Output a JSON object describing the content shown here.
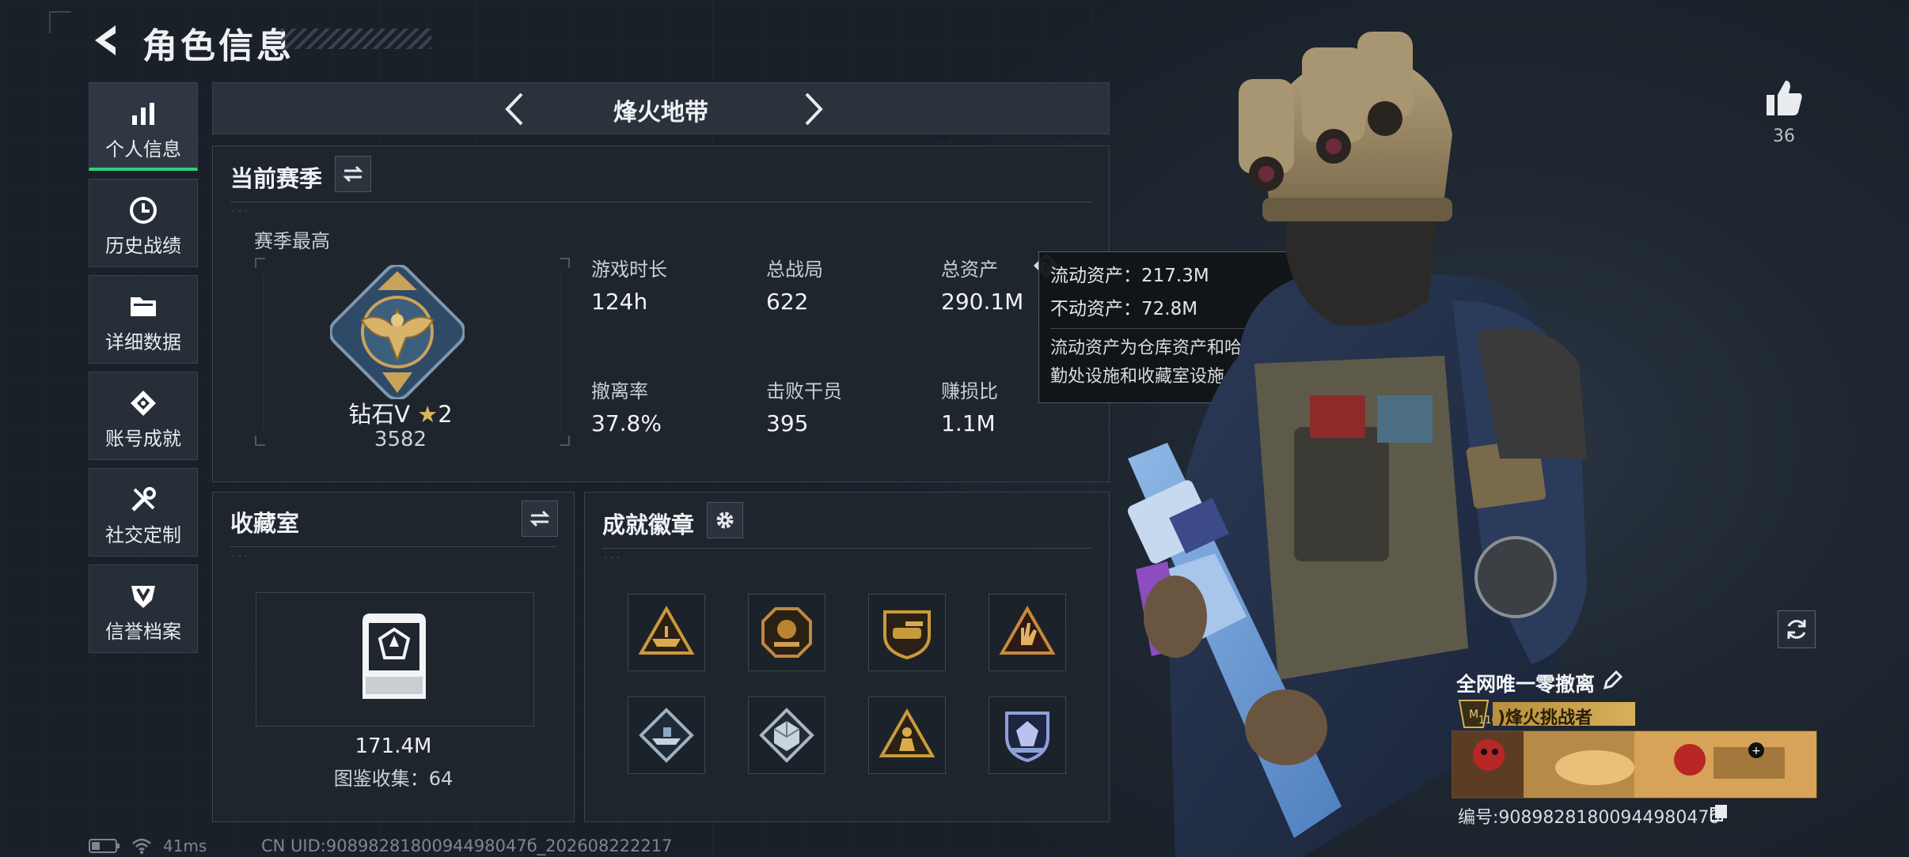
{
  "header": {
    "title": "角色信息"
  },
  "sidebar": {
    "items": [
      {
        "label": "个人信息",
        "icon": "bar-chart-icon",
        "active": true
      },
      {
        "label": "历史战绩",
        "icon": "clock-icon",
        "active": false
      },
      {
        "label": "详细数据",
        "icon": "folder-icon",
        "active": false
      },
      {
        "label": "账号成就",
        "icon": "achievement-icon",
        "active": false
      },
      {
        "label": "社交定制",
        "icon": "tools-icon",
        "active": false
      },
      {
        "label": "信誉档案",
        "icon": "credit-icon",
        "active": false
      }
    ]
  },
  "mode": {
    "label": "烽火地带"
  },
  "season": {
    "title": "当前赛季",
    "best_label": "赛季最高",
    "rank_name": "钻石V",
    "rank_stars": "2",
    "rank_score": "3582",
    "stats": [
      {
        "label": "游戏时长",
        "value": "124h"
      },
      {
        "label": "总战局",
        "value": "622"
      },
      {
        "label": "总资产",
        "value": "290.1M"
      },
      {
        "label": "撤离率",
        "value": "37.8%"
      },
      {
        "label": "击败干员",
        "value": "395"
      },
      {
        "label": "赚损比",
        "value": "1.1M"
      }
    ]
  },
  "tooltip": {
    "liquid": "流动资产：217.3M",
    "fixed": "不动资产：72.8M",
    "desc": "流动资产为仓库资产和哈夫币，不动资产为特勤处设施和收藏室设施"
  },
  "collection": {
    "title": "收藏室",
    "value": "171.4M",
    "count_label": "图鉴收集：64"
  },
  "badges": {
    "title": "成就徽章",
    "items": [
      {
        "icon": "tri-ship-badge-icon",
        "color": "#c99a3c"
      },
      {
        "icon": "octagon-crest-badge-icon",
        "color": "#c08a3c"
      },
      {
        "icon": "shield-tank-badge-icon",
        "color": "#c99a3c"
      },
      {
        "icon": "hand-badge-icon",
        "color": "#c88a3a"
      },
      {
        "icon": "diamond-ship-badge-icon",
        "color": "#9fb0c4"
      },
      {
        "icon": "diamond-cube-badge-icon",
        "color": "#a9b6c6"
      },
      {
        "icon": "tri-figure-badge-icon",
        "color": "#c99a3c"
      },
      {
        "icon": "shield-gem-badge-icon",
        "color": "#8ea0d8"
      }
    ]
  },
  "profile": {
    "likes": "36",
    "card_title": "全网唯一零撤离",
    "rank_level": "116",
    "rank_title": ")烽火挑战者",
    "card_uid": "编号:9089828180094498047б"
  },
  "footer": {
    "ping": "41ms",
    "uid": "CN UID:9089828180094498047б_202608222217"
  }
}
